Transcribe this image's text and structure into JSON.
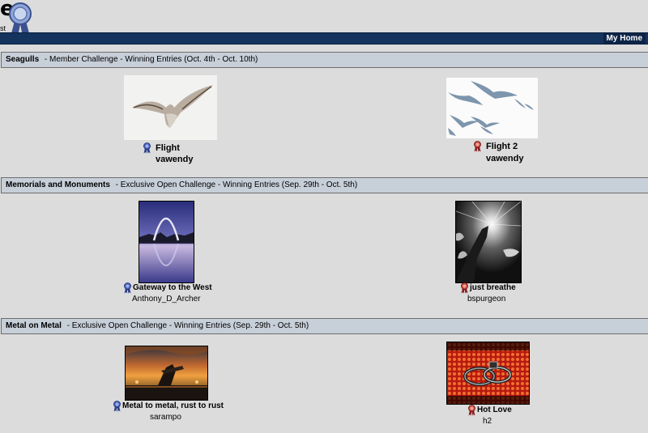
{
  "header": {
    "logo_letter": "e",
    "logo_sub": "st",
    "nav_link": "My Home"
  },
  "sections": [
    {
      "title": "Seagulls",
      "description": " - Member Challenge - Winning Entries (Oct. 4th - Oct. 10th)",
      "entries": [
        {
          "title": "Flight",
          "user": "vawendy",
          "ribbon": "blue"
        },
        {
          "title": "Flight 2",
          "user": "vawendy",
          "ribbon": "red"
        }
      ]
    },
    {
      "title": "Memorials and Monuments",
      "description": " - Exclusive Open Challenge - Winning Entries (Sep. 29th - Oct. 5th)",
      "entries": [
        {
          "title": "Gateway to the West",
          "user": "Anthony_D_Archer",
          "ribbon": "blue"
        },
        {
          "title": "just breathe",
          "user": "bspurgeon",
          "ribbon": "red"
        }
      ]
    },
    {
      "title": "Metal on Metal",
      "description": " - Exclusive Open Challenge - Winning Entries (Sep. 29th - Oct. 5th)",
      "entries": [
        {
          "title": "Metal to metal, rust to rust",
          "user": "sarampo",
          "ribbon": "blue"
        },
        {
          "title": "Hot Love",
          "user": "h2",
          "ribbon": "red"
        }
      ]
    }
  ],
  "colors": {
    "navbar": "#14345e",
    "section_header": "#c7cfd9",
    "blue_ribbon": "#3b4fa0",
    "red_ribbon": "#c0392b"
  }
}
